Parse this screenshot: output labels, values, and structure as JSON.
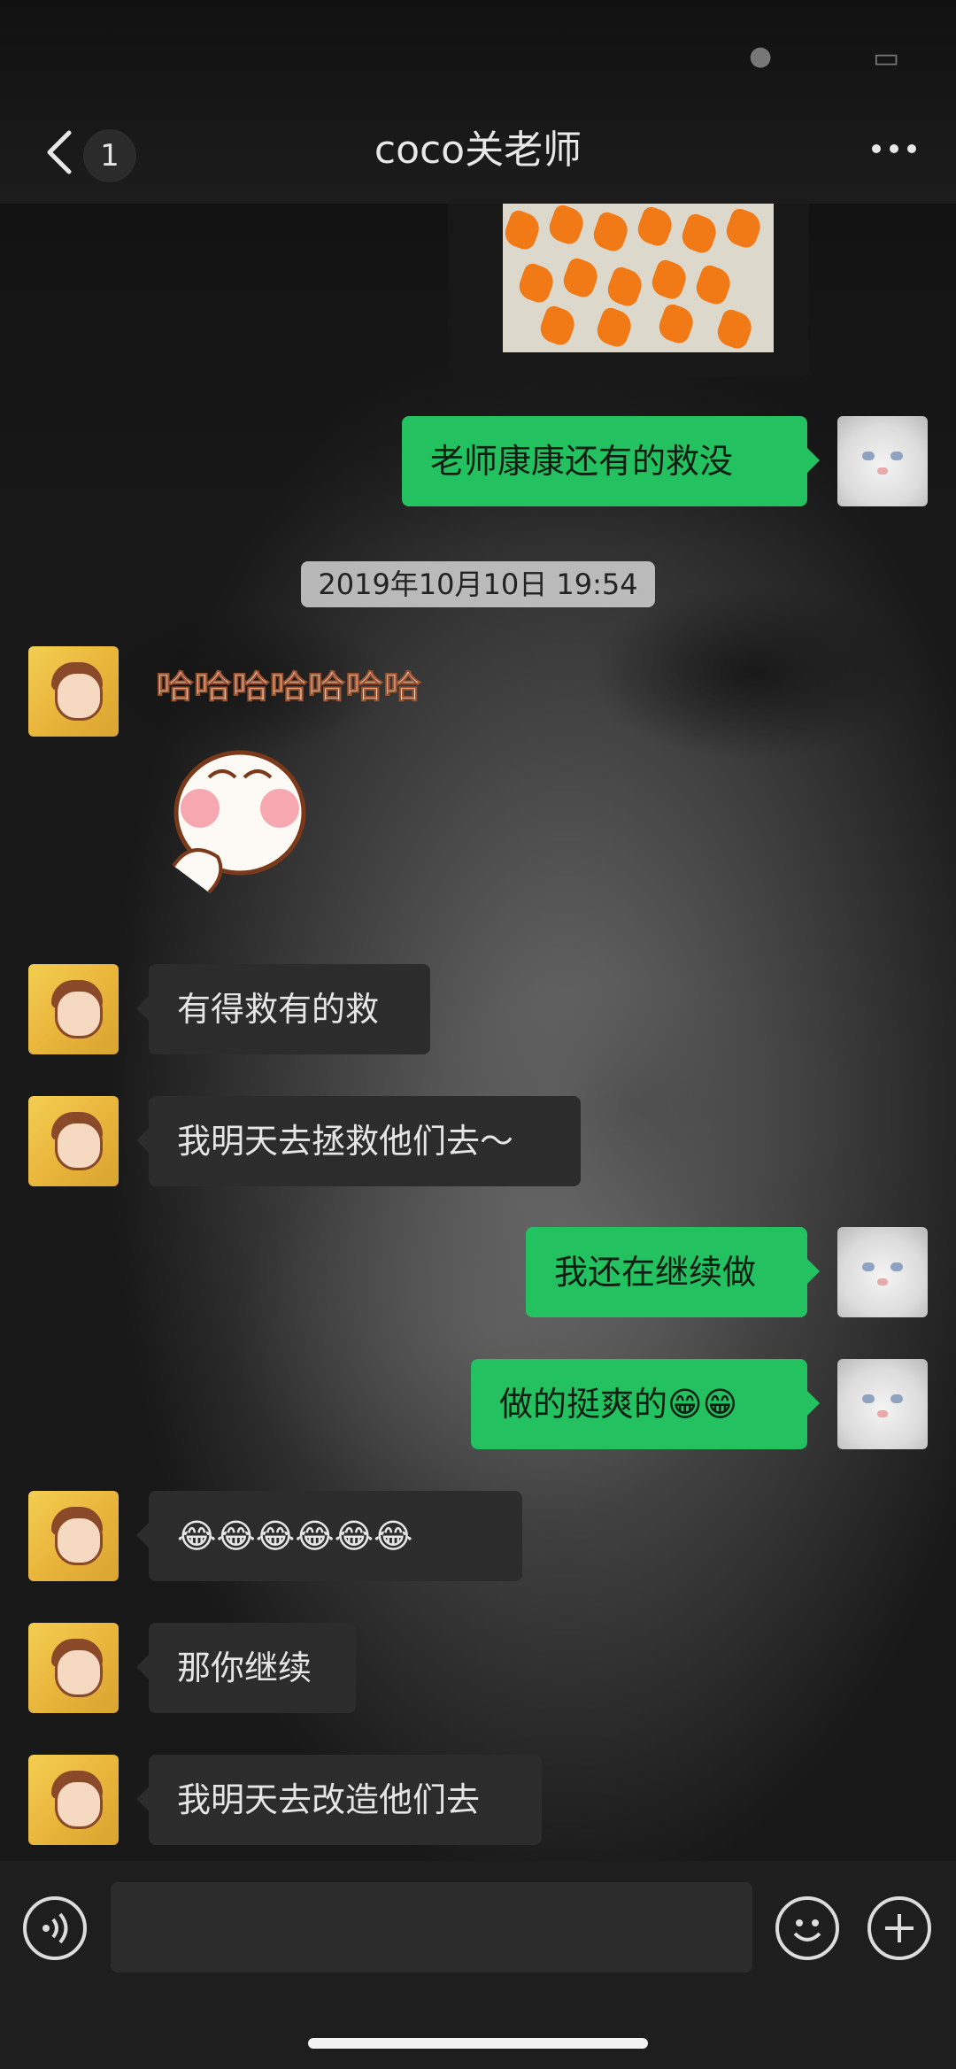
{
  "nav": {
    "back_icon": "chevron-left-icon",
    "unread_count": "1",
    "title": "coco关老师",
    "more_icon": "more-dots-icon"
  },
  "timestamp": "2019年10月10日 19:54",
  "messages": [
    {
      "from": "self",
      "text": "老师康康还有的救没"
    },
    {
      "from": "friend",
      "text": "有得救有的救"
    },
    {
      "from": "friend",
      "text": "我明天去拯救他们去～"
    },
    {
      "from": "self",
      "text": "我还在继续做"
    },
    {
      "from": "self",
      "text": "做的挺爽的😁😁"
    },
    {
      "from": "friend",
      "text": "😂😂😂😂😂😂"
    },
    {
      "from": "friend",
      "text": "那你继续"
    },
    {
      "from": "friend",
      "text": "我明天去改造他们去"
    }
  ],
  "sticker": {
    "text": "哈哈哈哈哈哈哈"
  },
  "inputbar": {
    "voice_icon": "voice-icon",
    "emoji_icon": "emoji-icon",
    "plus_icon": "plus-icon"
  },
  "colors": {
    "self_bubble": "#23c160",
    "friend_bubble": "#2c2c2c",
    "nav_bg": "#1c1c1c"
  }
}
